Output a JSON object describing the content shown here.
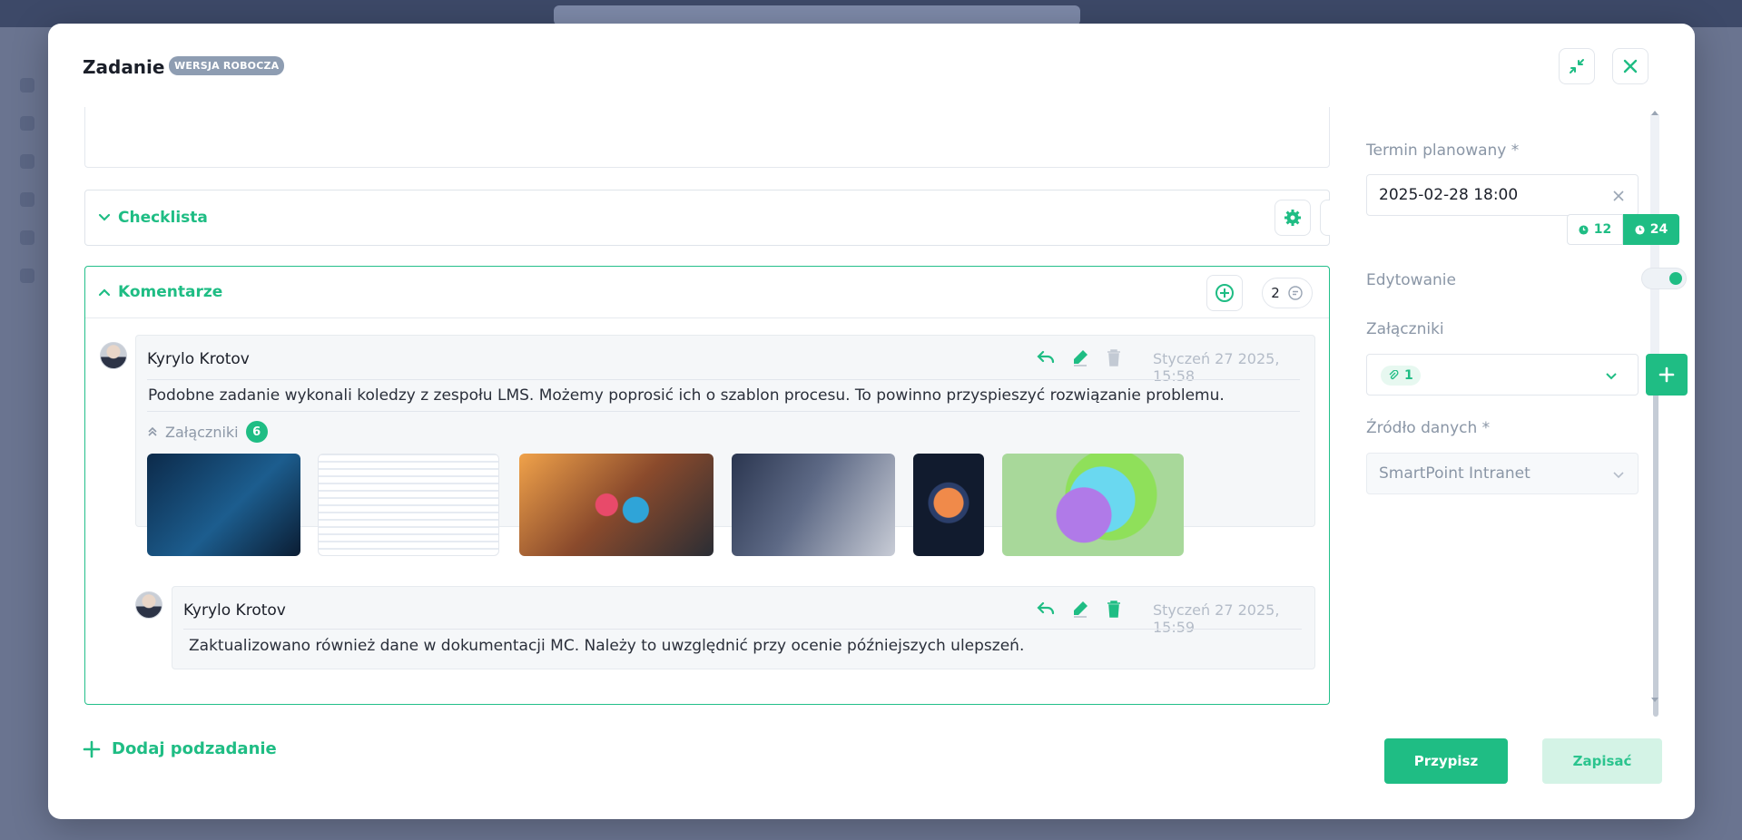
{
  "modal": {
    "title": "Zadanie",
    "badge": "WERSJA ROBOCZA"
  },
  "checklist": {
    "label": "Checklista"
  },
  "comments": {
    "label": "Komentarze",
    "count": "2",
    "items": [
      {
        "author": "Kyrylo Krotov",
        "time": "Styczeń 27 2025, 15:58",
        "text": "Podobne zadanie wykonali koledzy z zespołu LMS. Możemy poprosić ich o szablon procesu. To powinno przyspieszyć rozwiązanie problemu.",
        "attachments_label": "Załączniki",
        "attachments_count": "6"
      },
      {
        "author": "Kyrylo Krotov",
        "time": "Styczeń 27 2025, 15:59",
        "text": "Zaktualizowano również dane w dokumentacji MC. Należy to uwzględnić przy ocenie późniejszych ulepszeń."
      }
    ]
  },
  "sidebar": {
    "deadline_label": "Termin planowany *",
    "deadline_value": "2025-02-28 18:00",
    "time_format_12": "12",
    "time_format_24": "24",
    "editing_label": "Edytowanie",
    "attachments_label": "Załączniki",
    "attachments_count": "1",
    "source_label": "Źródło danych *",
    "source_value": "SmartPoint Intranet"
  },
  "footer": {
    "add_subtask": "Dodaj podzadanie",
    "assign": "Przypisz",
    "save": "Zapisać"
  },
  "colors": {
    "accent": "#1fbd84",
    "muted": "#8a96a6"
  }
}
